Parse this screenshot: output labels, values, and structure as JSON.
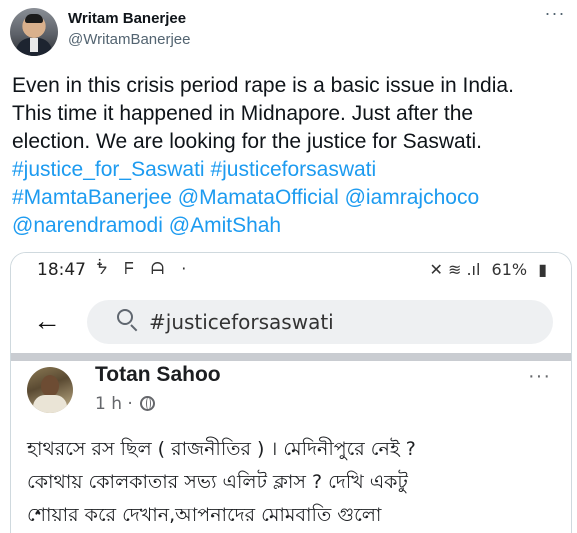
{
  "tweet": {
    "author_name": "Writam Banerjee",
    "author_handle": "@WritamBanerjee",
    "more_label": "···",
    "text_lines": [
      [
        {
          "t": "Even in this crisis period rape is a basic issue in India.",
          "tag": false
        }
      ],
      [
        {
          "t": "This time it happened in Midnapore. Just after the",
          "tag": false
        }
      ],
      [
        {
          "t": "election. We are looking for the justice for Saswati.",
          "tag": false
        }
      ],
      [
        {
          "t": "#justice_for_Saswati",
          "tag": true
        },
        {
          "t": " ",
          "tag": false
        },
        {
          "t": "#justiceforsaswati",
          "tag": true
        }
      ],
      [
        {
          "t": "#MamtaBanerjee",
          "tag": true
        },
        {
          "t": "  ",
          "tag": false
        },
        {
          "t": "@MamataOfficial",
          "tag": true
        },
        {
          "t": " ",
          "tag": false
        },
        {
          "t": "@iamrajchoco",
          "tag": true
        }
      ],
      [
        {
          "t": "@narendramodi",
          "tag": true
        },
        {
          "t": " ",
          "tag": false
        },
        {
          "t": "@AmitShah",
          "tag": true
        }
      ]
    ]
  },
  "screenshot": {
    "status_time": "18:47",
    "status_left_icons": "ᖭ ᖴ ᗩ ·",
    "status_right_icons": "✕ ≋ .ıl",
    "battery": "61%",
    "back_icon": "←",
    "search_query": "#justiceforsaswati",
    "poster_name": "Totan Sahoo",
    "post_time": "1 h ·",
    "post_more": "···",
    "post_lines": [
      "হাথরসে রস ছিল ( রাজনীতির ) । মেদিনীপুরে নেই ?",
      "কোথায় কোলকাতার সভ্য এলিট ক্লাস ? দেখি একটু",
      "শোয়ার করে দেখান,আপনাদের মোমবাতি গুলো"
    ]
  }
}
